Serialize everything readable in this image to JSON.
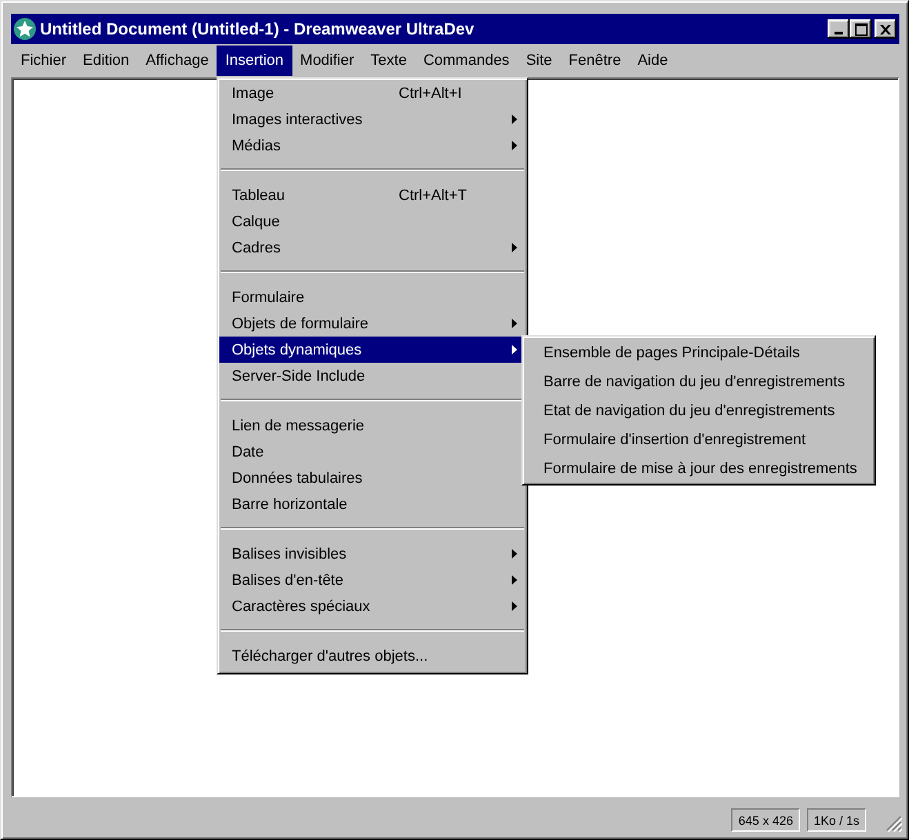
{
  "window": {
    "title": "Untitled Document (Untitled-1) - Dreamweaver UltraDev"
  },
  "menu_bar": [
    {
      "label": "Fichier",
      "selected": false
    },
    {
      "label": "Edition",
      "selected": false
    },
    {
      "label": "Affichage",
      "selected": false
    },
    {
      "label": "Insertion",
      "selected": true
    },
    {
      "label": "Modifier",
      "selected": false
    },
    {
      "label": "Texte",
      "selected": false
    },
    {
      "label": "Commandes",
      "selected": false
    },
    {
      "label": "Site",
      "selected": false
    },
    {
      "label": "Fenêtre",
      "selected": false
    },
    {
      "label": "Aide",
      "selected": false
    }
  ],
  "insertion_menu": {
    "groups": [
      {
        "items": [
          {
            "label": "Image",
            "shortcut": "Ctrl+Alt+I",
            "has_submenu": false,
            "selected": false
          },
          {
            "label": "Images interactives",
            "has_submenu": true,
            "selected": false
          },
          {
            "label": "Médias",
            "has_submenu": true,
            "selected": false
          }
        ]
      },
      {
        "items": [
          {
            "label": "Tableau",
            "shortcut": "Ctrl+Alt+T",
            "has_submenu": false,
            "selected": false
          },
          {
            "label": "Calque",
            "has_submenu": false,
            "selected": false
          },
          {
            "label": "Cadres",
            "has_submenu": true,
            "selected": false
          }
        ]
      },
      {
        "items": [
          {
            "label": "Formulaire",
            "has_submenu": false,
            "selected": false
          },
          {
            "label": "Objets de formulaire",
            "has_submenu": true,
            "selected": false
          },
          {
            "label": "Objets dynamiques",
            "has_submenu": true,
            "selected": true
          },
          {
            "label": "Server-Side Include",
            "has_submenu": false,
            "selected": false
          }
        ]
      },
      {
        "items": [
          {
            "label": "Lien de messagerie",
            "has_submenu": false,
            "selected": false
          },
          {
            "label": "Date",
            "has_submenu": false,
            "selected": false
          },
          {
            "label": "Données tabulaires",
            "has_submenu": false,
            "selected": false
          },
          {
            "label": "Barre horizontale",
            "has_submenu": false,
            "selected": false
          }
        ]
      },
      {
        "items": [
          {
            "label": "Balises invisibles",
            "has_submenu": true,
            "selected": false
          },
          {
            "label": "Balises d'en-tête",
            "has_submenu": true,
            "selected": false
          },
          {
            "label": "Caractères spéciaux",
            "has_submenu": true,
            "selected": false
          }
        ]
      },
      {
        "items": [
          {
            "label": "Télécharger d'autres objets...",
            "has_submenu": false,
            "selected": false
          }
        ]
      }
    ]
  },
  "submenu": {
    "items": [
      {
        "label": "Ensemble de pages Principale-Détails",
        "selected": false
      },
      {
        "label": "Barre de navigation du jeu d'enregistrements",
        "selected": false
      },
      {
        "label": "Etat de navigation du jeu d'enregistrements",
        "selected": false
      },
      {
        "label": "Formulaire d'insertion d'enregistrement",
        "selected": false
      },
      {
        "label": "Formulaire de mise à jour des enregistrements",
        "selected": false
      }
    ]
  },
  "status_bar": {
    "window_size": "645 x 426",
    "download_time": "1Ko / 1s"
  }
}
